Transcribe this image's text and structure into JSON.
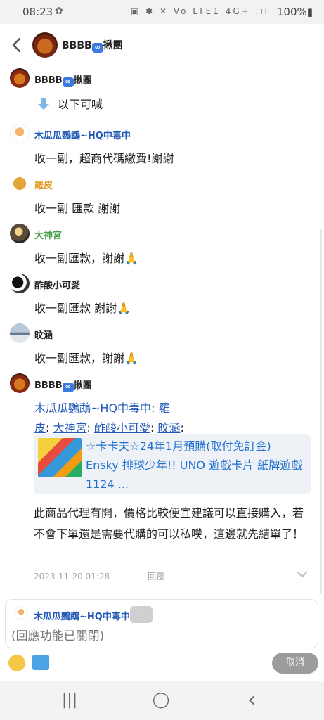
{
  "status_bar": {
    "time": "08:23",
    "left_icon": "✿",
    "right_icons": "▣ ✱ ✕ Vo LTE1 4G+ .ıl",
    "battery": "100%▮"
  },
  "header": {
    "title": "BBBB",
    "suffix": "揪團",
    "infinity_glyph": "∞"
  },
  "messages": [
    {
      "name": "BBBB",
      "name_suffix": "揪團",
      "body": "以下可喊"
    },
    {
      "name": "木瓜瓜鸚鵡~HQ中毒中",
      "body": "收一副，超商代碼繳費!謝謝"
    },
    {
      "name": "羅皮",
      "body": "收一副 匯款 謝謝"
    },
    {
      "name": "大神宮",
      "body": "收一副匯款，謝謝🙏"
    },
    {
      "name": "酢酸小可愛",
      "body": "收一副匯款 謝謝🙏"
    },
    {
      "name": "旼涵",
      "body": "收一副匯款，謝謝🙏"
    },
    {
      "name": "BBBB",
      "name_suffix": "揪團"
    }
  ],
  "mentions": {
    "m1": "木瓜瓜鸚鵡~HQ中毒中",
    "sep1": ": ",
    "m2a": "羅",
    "m2b": "皮",
    "sep2": ": ",
    "m3": "大神宮",
    "sep3": ": ",
    "m4": "酢酸小可愛",
    "sep4": ": ",
    "m5": "旼涵",
    "sep5": ":"
  },
  "link_card": {
    "title": "☆卡卡夫☆24年1月預購(取付免訂金) Ensky 排球少年!! UNO 遊戲卡片 紙牌遊戲 1124 ..."
  },
  "long_text": "此商品代理有開，價格比較便宜建議可以直接購入，若不會下單還是需要代購的可以私噗，這邊就先結單了！",
  "meta": {
    "timestamp": "2023-11-20 01:28",
    "reply": "回覆"
  },
  "compose": {
    "reply_to": "木瓜瓜鸚鵡~HQ中毒中",
    "chip": ":",
    "placeholder": "(回應功能已關閉)"
  },
  "actions": {
    "cancel": "取消"
  },
  "nav": {
    "recents": "|||",
    "home": "◯",
    "back": "‹"
  }
}
